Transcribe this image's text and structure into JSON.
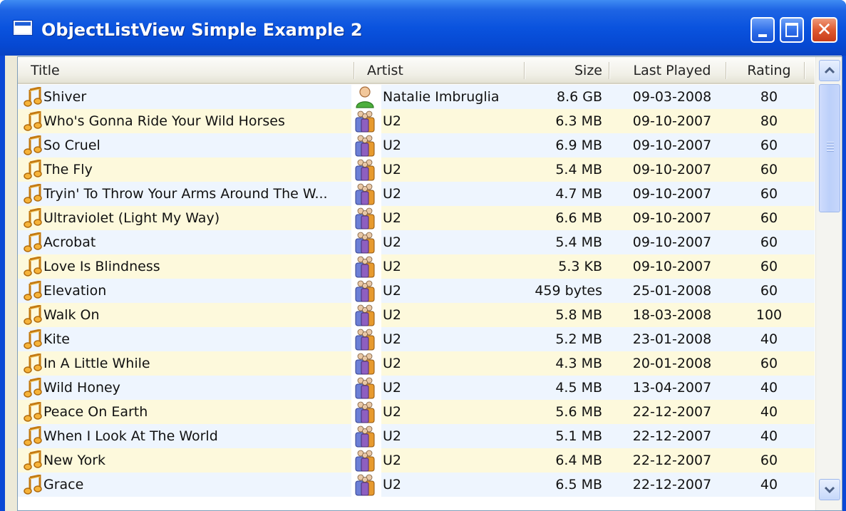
{
  "window": {
    "title": "ObjectListView Simple Example 2",
    "close_glyph": "✕",
    "colors": {
      "titlebar": "#0a53de",
      "row_odd": "#eef5fe",
      "row_even": "#fdf9dc"
    }
  },
  "columns": {
    "title": "Title",
    "artist": "Artist",
    "size": "Size",
    "last_played": "Last Played",
    "rating": "Rating"
  },
  "rows": [
    {
      "title": "Shiver",
      "artist": "Natalie Imbruglia",
      "artist_icon": "person-icon",
      "size": "8.6 GB",
      "last_played": "09-03-2008",
      "rating": "80"
    },
    {
      "title": "Who's Gonna Ride Your Wild Horses",
      "artist": "U2",
      "artist_icon": "group-icon",
      "size": "6.3 MB",
      "last_played": "09-10-2007",
      "rating": "80"
    },
    {
      "title": "So Cruel",
      "artist": "U2",
      "artist_icon": "group-icon",
      "size": "6.9 MB",
      "last_played": "09-10-2007",
      "rating": "60"
    },
    {
      "title": "The Fly",
      "artist": "U2",
      "artist_icon": "group-icon",
      "size": "5.4 MB",
      "last_played": "09-10-2007",
      "rating": "60"
    },
    {
      "title": "Tryin' To Throw Your Arms Around The W...",
      "artist": "U2",
      "artist_icon": "group-icon",
      "size": "4.7 MB",
      "last_played": "09-10-2007",
      "rating": "60"
    },
    {
      "title": "Ultraviolet (Light My Way)",
      "artist": "U2",
      "artist_icon": "group-icon",
      "size": "6.6 MB",
      "last_played": "09-10-2007",
      "rating": "60"
    },
    {
      "title": "Acrobat",
      "artist": "U2",
      "artist_icon": "group-icon",
      "size": "5.4 MB",
      "last_played": "09-10-2007",
      "rating": "60"
    },
    {
      "title": "Love Is Blindness",
      "artist": "U2",
      "artist_icon": "group-icon",
      "size": "5.3 KB",
      "last_played": "09-10-2007",
      "rating": "60"
    },
    {
      "title": "Elevation",
      "artist": "U2",
      "artist_icon": "group-icon",
      "size": "459 bytes",
      "last_played": "25-01-2008",
      "rating": "60"
    },
    {
      "title": "Walk On",
      "artist": "U2",
      "artist_icon": "group-icon",
      "size": "5.8 MB",
      "last_played": "18-03-2008",
      "rating": "100"
    },
    {
      "title": "Kite",
      "artist": "U2",
      "artist_icon": "group-icon",
      "size": "5.2 MB",
      "last_played": "23-01-2008",
      "rating": "40"
    },
    {
      "title": "In A Little While",
      "artist": "U2",
      "artist_icon": "group-icon",
      "size": "4.3 MB",
      "last_played": "20-01-2008",
      "rating": "60"
    },
    {
      "title": "Wild Honey",
      "artist": "U2",
      "artist_icon": "group-icon",
      "size": "4.5 MB",
      "last_played": "13-04-2007",
      "rating": "40"
    },
    {
      "title": "Peace On Earth",
      "artist": "U2",
      "artist_icon": "group-icon",
      "size": "5.6 MB",
      "last_played": "22-12-2007",
      "rating": "40"
    },
    {
      "title": "When I Look At The World",
      "artist": "U2",
      "artist_icon": "group-icon",
      "size": "5.1 MB",
      "last_played": "22-12-2007",
      "rating": "40"
    },
    {
      "title": "New York",
      "artist": "U2",
      "artist_icon": "group-icon",
      "size": "6.4 MB",
      "last_played": "22-12-2007",
      "rating": "60"
    },
    {
      "title": "Grace",
      "artist": "U2",
      "artist_icon": "group-icon",
      "size": "6.5 MB",
      "last_played": "22-12-2007",
      "rating": "40"
    }
  ],
  "scrollbar": {
    "up_icon": "chevron-up-icon",
    "down_icon": "chevron-down-icon"
  }
}
